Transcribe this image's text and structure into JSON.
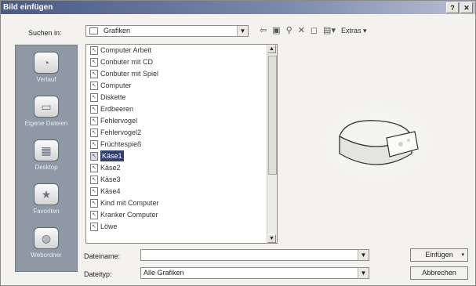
{
  "window": {
    "title": "Bild einfügen",
    "help_label": "?",
    "close_label": "✕"
  },
  "lookin": {
    "label": "Suchen in:",
    "value": "Grafiken"
  },
  "toolbar": {
    "extras_label": "Extras"
  },
  "places": [
    {
      "label": "Verlauf",
      "icon": "history-icon"
    },
    {
      "label": "Eigene Dateien",
      "icon": "my-documents-icon"
    },
    {
      "label": "Desktop",
      "icon": "desktop-icon"
    },
    {
      "label": "Favoriten",
      "icon": "favorites-icon"
    },
    {
      "label": "Webordner",
      "icon": "web-folders-icon"
    }
  ],
  "files": [
    {
      "label": "Computer Arbeit",
      "icon": "file-icon"
    },
    {
      "label": "Conbuter mit CD",
      "icon": "file-icon"
    },
    {
      "label": "Conbuter mit Spiel",
      "icon": "file-icon"
    },
    {
      "label": "Computer",
      "icon": "file-icon"
    },
    {
      "label": "Diskette",
      "icon": "file-icon"
    },
    {
      "label": "Erdbeeren",
      "icon": "file-icon"
    },
    {
      "label": "Fehlervogel",
      "icon": "file-icon"
    },
    {
      "label": "Fehlervogel2",
      "icon": "file-icon"
    },
    {
      "label": "Früchtespieß",
      "icon": "file-icon"
    },
    {
      "label": "Käse1",
      "icon": "file-icon"
    },
    {
      "label": "Käse2",
      "icon": "file-icon"
    },
    {
      "label": "Käse3",
      "icon": "file-icon"
    },
    {
      "label": "Käse4",
      "icon": "file-icon"
    },
    {
      "label": "Kind mit Computer",
      "icon": "file-icon"
    },
    {
      "label": "Kranker Computer",
      "icon": "file-icon"
    },
    {
      "label": "Löwe",
      "icon": "file-icon"
    }
  ],
  "selected_file": "Käse1",
  "filename": {
    "label": "Dateiname:",
    "value": ""
  },
  "filetype": {
    "label": "Dateityp:",
    "value": "Alle Grafiken"
  },
  "buttons": {
    "insert": "Einfügen",
    "cancel": "Abbrechen"
  },
  "colors": {
    "selection": "#33406c",
    "places_bar": "#8f98a5",
    "title_bar": "#4a5a86"
  }
}
